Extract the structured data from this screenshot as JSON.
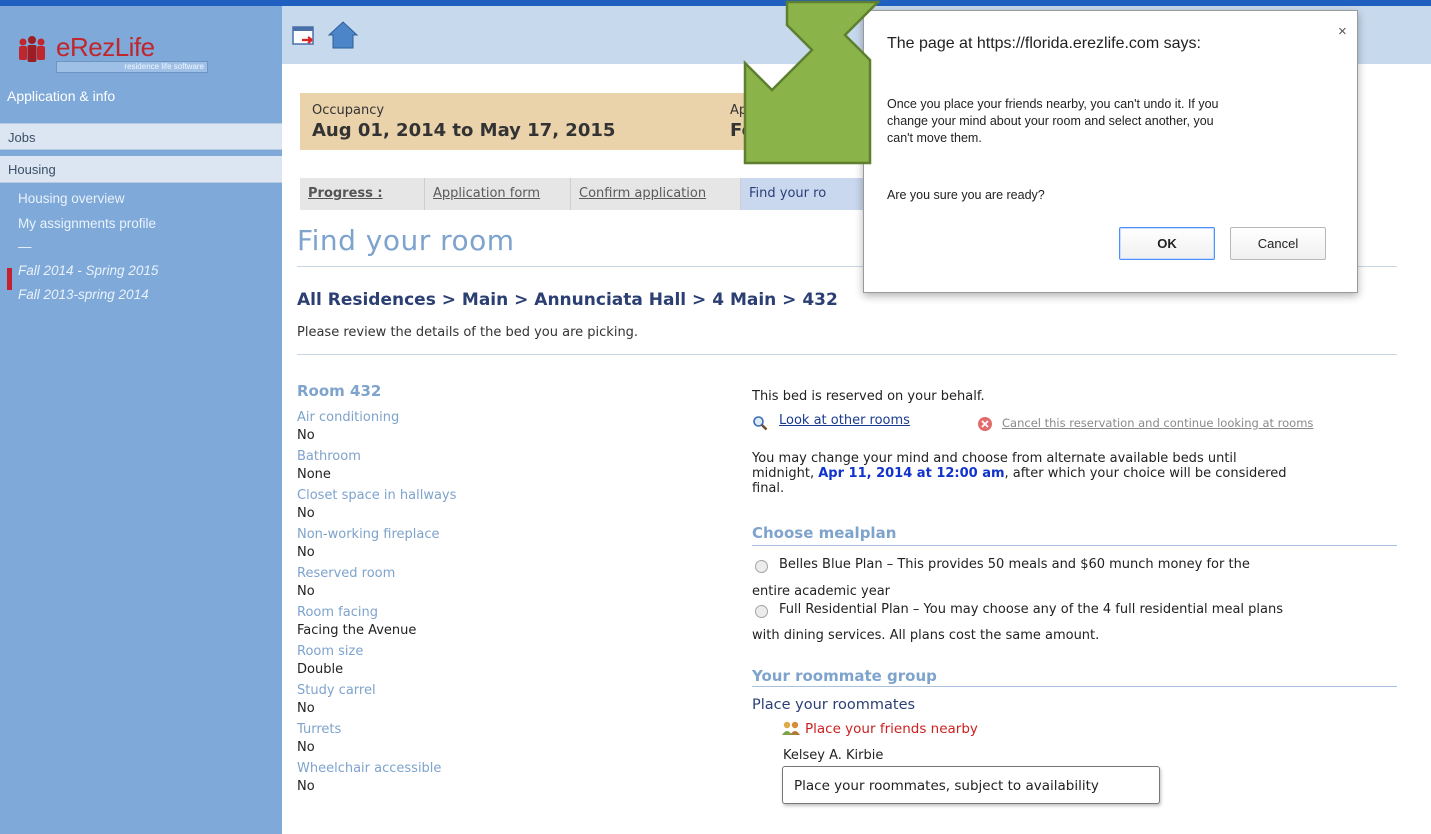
{
  "app": {
    "logo_text": "eRezLife",
    "logo_sub": "residence life software"
  },
  "sidebar": {
    "heading": "Application & info",
    "items": [
      {
        "label": "Jobs"
      },
      {
        "label": "Housing"
      }
    ],
    "links": [
      {
        "label": "Housing overview"
      },
      {
        "label": "My assignments profile"
      },
      {
        "label": "—"
      },
      {
        "label": "Fall 2014 - Spring 2015"
      },
      {
        "label": "Fall 2013-spring 2014"
      }
    ]
  },
  "info": {
    "occupancy_label": "Occupancy",
    "occupancy_value": "Aug 01, 2014 to May 17, 2015",
    "deadline_label": "Application dea",
    "deadline_value": "Feb 07, 201"
  },
  "tabs": {
    "progress": "Progress :",
    "items": [
      {
        "label": "Application form"
      },
      {
        "label": "Confirm application"
      },
      {
        "label": "Find your ro"
      }
    ]
  },
  "page": {
    "title": "Find your room",
    "breadcrumb": "All Residences > Main > Annunciata Hall > 4 Main > 432",
    "review_text": "Please review the details of the bed you are picking."
  },
  "room": {
    "title": "Room 432",
    "attributes": [
      {
        "key": "Air conditioning",
        "value": "No"
      },
      {
        "key": "Bathroom",
        "value": "None"
      },
      {
        "key": "Closet space in hallways",
        "value": "No"
      },
      {
        "key": "Non-working fireplace",
        "value": "No"
      },
      {
        "key": "Reserved room",
        "value": "No"
      },
      {
        "key": "Room facing",
        "value": "Facing the Avenue"
      },
      {
        "key": "Room size",
        "value": "Double"
      },
      {
        "key": "Study carrel",
        "value": "No"
      },
      {
        "key": "Turrets",
        "value": "No"
      },
      {
        "key": "Wheelchair accessible",
        "value": "No"
      }
    ]
  },
  "reservation": {
    "reserved_text": "This bed is reserved on your behalf.",
    "look_link": "Look at other rooms",
    "cancel_link": "Cancel this reservation and continue looking at rooms",
    "change_text_1": "You may change your mind and choose from alternate available beds until",
    "change_text_2a": "midnight, ",
    "change_date": "Apr 11, 2014 at 12:00 am",
    "change_text_2b": ", after which your choice will be considered",
    "change_text_3": "final."
  },
  "mealplan": {
    "title": "Choose mealplan",
    "option1_line1": "Belles Blue Plan – This provides 50 meals and $60 munch money for the",
    "option1_line2": "entire academic year",
    "option2_line1": "Full Residential Plan – You may choose any of the 4 full residential meal plans",
    "option2_line2": "with dining services. All plans cost the same amount."
  },
  "roommates": {
    "title": "Your roommate group",
    "place_label": "Place your roommates",
    "friends_link": "Place your friends nearby",
    "member": "Kelsey A. Kirbie",
    "tooltip": "Place your roommates, subject to availability"
  },
  "dialog": {
    "title": "The page at https://florida.erezlife.com says:",
    "close": "×",
    "message_1": "Once you place your friends nearby, you can't undo it. If you",
    "message_2": "change your mind about your room and select another, you",
    "message_3": "can't move them.",
    "question": "Are you sure you are ready?",
    "ok_label": "OK",
    "cancel_label": "Cancel"
  },
  "colors": {
    "sidebar": "#7ea9d8",
    "header": "#c7d9ec",
    "info_box": "#ead2ab",
    "accent_blue": "#7ea3cc",
    "arrow_green": "#8ab34a"
  }
}
